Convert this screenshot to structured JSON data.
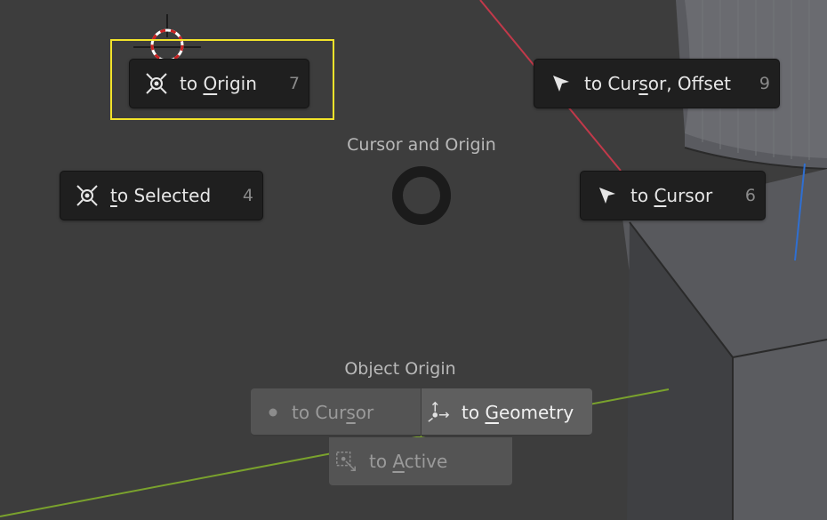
{
  "pie_menu": {
    "title": "Cursor and Origin",
    "items": {
      "to_origin": {
        "pre": "to ",
        "ul": "O",
        "post": "rigin",
        "hotkey": "7",
        "icon": "snap-origin-icon"
      },
      "to_cursor_offset": {
        "pre": "to Cur",
        "ul": "s",
        "post": "or, Offset",
        "hotkey": "9",
        "icon": "cursor-arrow-icon"
      },
      "to_selected": {
        "pre": "",
        "ul": "t",
        "post": "o Selected",
        "hotkey": "4",
        "icon": "snap-origin-icon"
      },
      "to_cursor": {
        "pre": "to ",
        "ul": "C",
        "post": "ursor",
        "hotkey": "6",
        "icon": "cursor-arrow-icon"
      }
    }
  },
  "object_origin": {
    "title": "Object Origin",
    "to_cursor": {
      "pre": "to Cur",
      "ul": "s",
      "post": "or",
      "icon": "dot-icon"
    },
    "to_geometry": {
      "pre": "to ",
      "ul": "G",
      "post": "eometry",
      "icon": "origin-to-geometry-icon"
    },
    "to_active": {
      "pre": "to ",
      "ul": "A",
      "post": "ctive",
      "icon": "active-object-icon"
    }
  },
  "colors": {
    "highlight": "#f2e32a",
    "x_axis": "#c2394a",
    "y_axis": "#7aa22d",
    "z_axis": "#2f6fd1",
    "cursor_red": "#cc2222"
  }
}
